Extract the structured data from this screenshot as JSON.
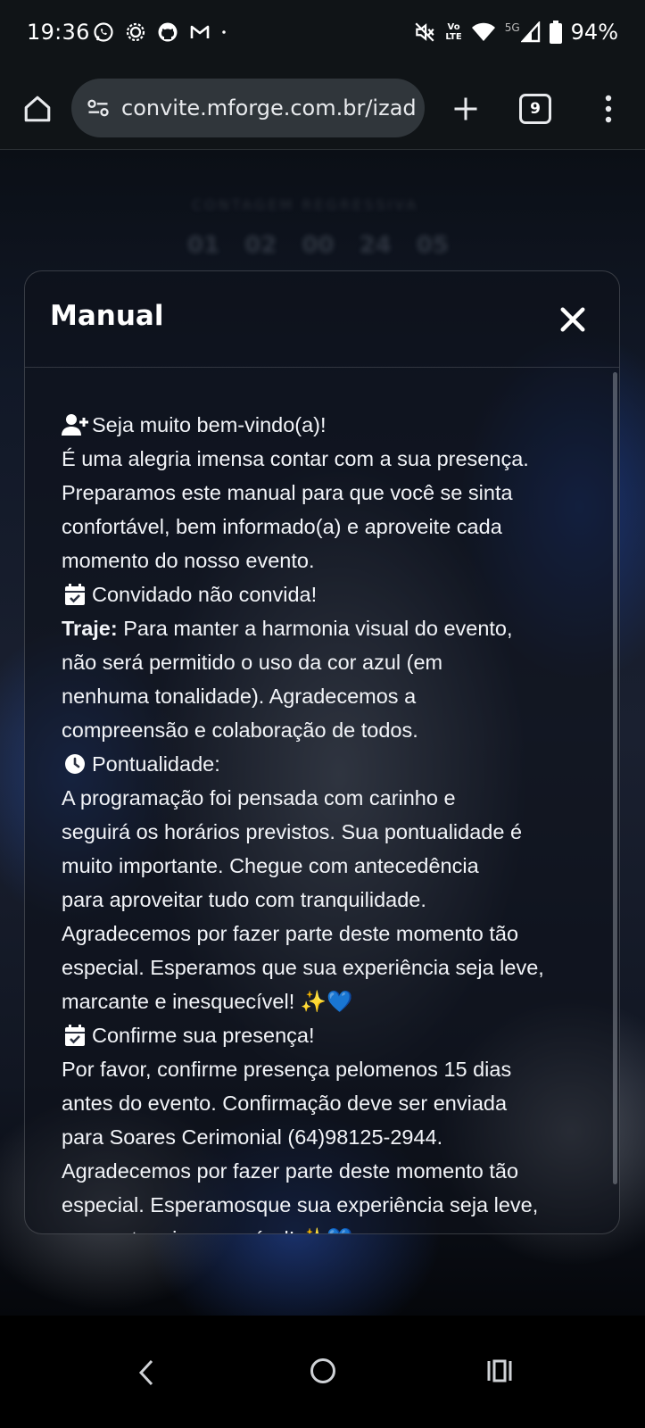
{
  "status_bar": {
    "time": "19:36",
    "left_icons": [
      "whatsapp-icon",
      "signal-app-icon",
      "github-icon",
      "gmail-icon",
      "dot-icon"
    ],
    "right_icons": [
      "mute-icon",
      "volte-icon",
      "wifi-icon",
      "5g-signal-icon",
      "battery-icon"
    ],
    "volte_label_top": "Vo",
    "volte_label_bottom": "LTE",
    "network_label": "5G",
    "battery": "94%"
  },
  "browser": {
    "url": "convite.mforge.com.br/izad",
    "tab_count": "9"
  },
  "background": {
    "countdown_label": "CONTAGEM REGRESSIVA",
    "countdown": [
      "01",
      "02",
      "00",
      "24",
      "05"
    ]
  },
  "modal": {
    "title": "Manual",
    "lines": {
      "l1": "Seja muito bem-vindo(a)!",
      "l2": "É uma alegria imensa contar com a sua presença.",
      "l3": "Preparamos este manual para que você se sinta",
      "l4": "confortável, bem informado(a) e aproveite cada",
      "l5": "momento do nosso evento.",
      "l6": "Convidado não convida!",
      "l7_bold": "Traje:",
      "l7": " Para manter a harmonia visual do evento,",
      "l8": "não será permitido o uso da cor azul (em",
      "l9": "nenhuma tonalidade). Agradecemos a",
      "l10": "compreensão e colaboração de todos.",
      "l11": "Pontualidade:",
      "l12": "A programação foi pensada com carinho e",
      "l13": "seguirá os horários previstos. Sua pontualidade é",
      "l14": "muito importante. Chegue com antecedência",
      "l15": "para aproveitar tudo com tranquilidade.",
      "l16": "Agradecemos por fazer parte deste momento tão",
      "l17": "especial. Esperamos que sua experiência seja leve,",
      "l18": "marcante e inesquecível! ✨💙",
      "l19": "Confirme sua presença!",
      "l20": "Por favor, confirme presença pelomenos 15 dias",
      "l21": "antes do evento. Confirmação deve ser enviada",
      "l22": "para Soares Cerimonial (64)98125-2944.",
      "l23": "Agradecemos por fazer parte deste momento tão",
      "l24": "especial. Esperamosque sua experiência seja leve,",
      "l25": "marcante e inesquecível! ✨💙"
    }
  },
  "colors": {
    "accent_blue": "#1e4fd0",
    "modal_bg": "#0e121a",
    "browser_bar": "#101417"
  }
}
